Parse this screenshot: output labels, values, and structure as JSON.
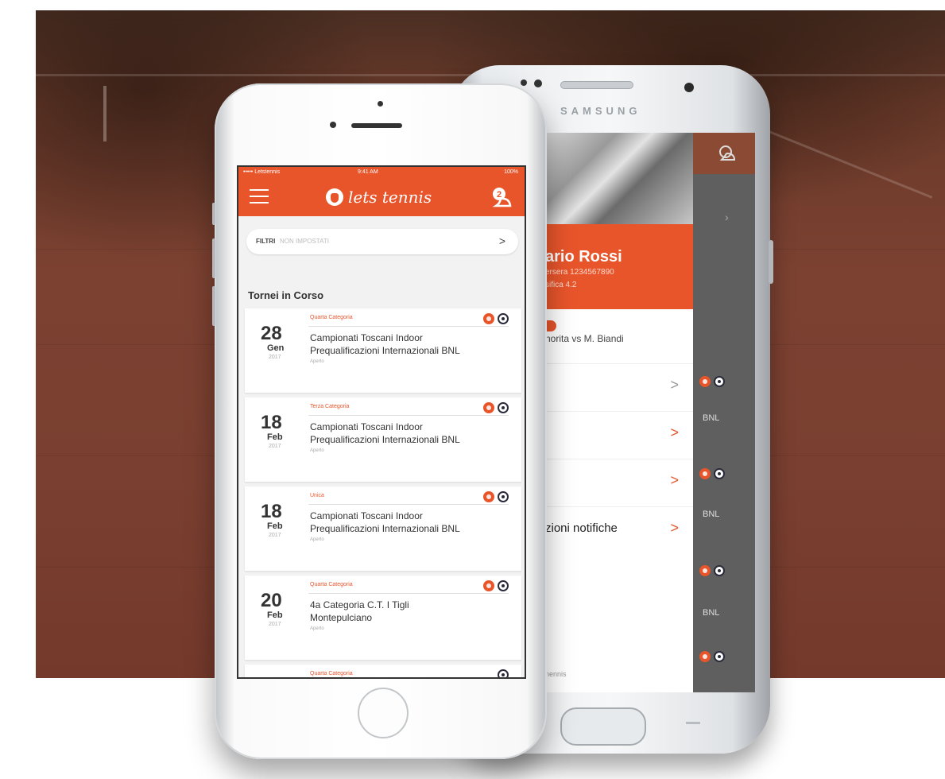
{
  "samsung": {
    "brand": "SAMSUNG",
    "drawer": {
      "name": "ario Rossi",
      "member_no": "ersera 1234567890",
      "classifica": "sifica 4.2",
      "notification_line": "norita vs M. Biandi",
      "rows": [
        {
          "label": "",
          "chev": ">"
        },
        {
          "label": "",
          "chev": ">"
        },
        {
          "label": "",
          "chev": ">"
        },
        {
          "label": "zioni notifiche",
          "chev": ">"
        }
      ],
      "footer": "nennis"
    },
    "background_rows": [
      "BNL",
      "BNL",
      "BNL"
    ]
  },
  "iphone": {
    "status": {
      "carrier": "••••• Letstennis",
      "time": "9:41 AM",
      "battery": "100%"
    },
    "app_name": "lets tennis",
    "filter": {
      "label": "FILTRI",
      "value": "NON IMPOSTATI",
      "chev": ">"
    },
    "section_title": "Tornei in Corso",
    "cards": [
      {
        "day": "28",
        "month": "Gen",
        "year": "2017",
        "category": "Quarta Categoria",
        "title1": "Campionati Toscani Indoor",
        "title2": "Prequalificazioni Internazionali BNL",
        "status": "Aperto",
        "badges": [
          "o",
          "d"
        ]
      },
      {
        "day": "18",
        "month": "Feb",
        "year": "2017",
        "category": "Terza Categoria",
        "title1": "Campionati Toscani Indoor",
        "title2": "Prequalificazioni Internazionali BNL",
        "status": "Aperto",
        "badges": [
          "o",
          "d"
        ]
      },
      {
        "day": "18",
        "month": "Feb",
        "year": "2017",
        "category": "Unica",
        "title1": "Campionati Toscani Indoor",
        "title2": "Prequalificazioni Internazionali BNL",
        "status": "Aperto",
        "badges": [
          "o",
          "d"
        ]
      },
      {
        "day": "20",
        "month": "Feb",
        "year": "2017",
        "category": "Quarta Categoria",
        "title1": "4a Categoria C.T. I Tigli",
        "title2": "Montepulciano",
        "status": "Aperto",
        "badges": [
          "o",
          "d"
        ]
      },
      {
        "day": "",
        "month": "",
        "year": "",
        "category": "Quarta Categoria",
        "title1": "",
        "title2": "",
        "status": "",
        "badges": [
          "d"
        ]
      }
    ],
    "notification_count": "2"
  },
  "colors": {
    "accent": "#e8552b",
    "court": "#7c4131"
  }
}
